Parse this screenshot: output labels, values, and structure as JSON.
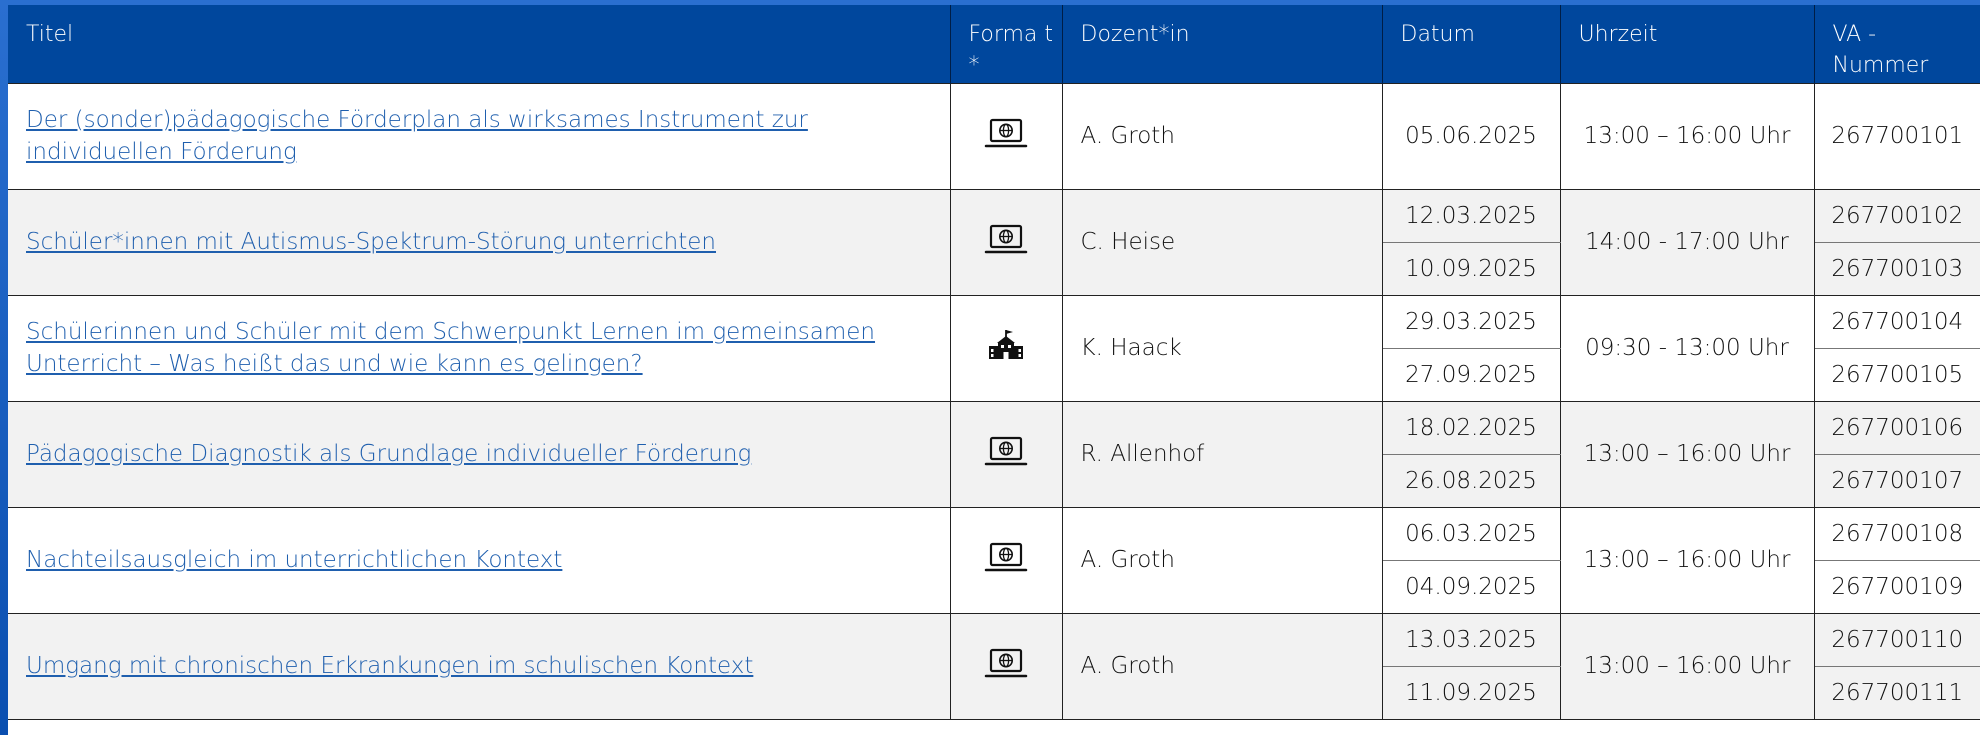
{
  "headers": {
    "titel": "Titel",
    "format": "Forma t *",
    "dozent": "Dozent*in",
    "datum": "Datum",
    "uhrzeit": "Uhrzeit",
    "va": "VA - Nummer"
  },
  "rows": [
    {
      "title": "Der (sonder)pädagogische Förderplan als wirksames Instrument zur individuellen Förderung",
      "format_icon": "laptop-globe-icon",
      "lecturer": "A. Groth",
      "dates": [
        "05.06.2025"
      ],
      "time": "13:00 – 16:00 Uhr",
      "va": [
        "267700101"
      ]
    },
    {
      "title": "Schüler*innen mit Autismus-Spektrum-Störung unterrichten",
      "format_icon": "laptop-globe-icon",
      "lecturer": "C. Heise",
      "dates": [
        "12.03.2025",
        "10.09.2025"
      ],
      "time": "14:00 - 17:00 Uhr",
      "va": [
        "267700102",
        "267700103"
      ]
    },
    {
      "title": "Schülerinnen und Schüler mit dem Schwerpunkt Lernen im gemeinsamen Unterricht – Was heißt das und wie kann es gelingen?",
      "format_icon": "school-building-icon",
      "lecturer": "K. Haack",
      "dates": [
        "29.03.2025",
        "27.09.2025"
      ],
      "time": "09:30 - 13:00 Uhr",
      "va": [
        "267700104",
        "267700105"
      ]
    },
    {
      "title": "Pädagogische Diagnostik als Grundlage individueller Förderung",
      "format_icon": "laptop-globe-icon",
      "lecturer": "R. Allenhof",
      "dates": [
        "18.02.2025",
        "26.08.2025"
      ],
      "time": "13:00 – 16:00 Uhr",
      "va": [
        "267700106",
        "267700107"
      ]
    },
    {
      "title": "Nachteilsausgleich im unterrichtlichen Kontext",
      "format_icon": "laptop-globe-icon",
      "lecturer": "A. Groth",
      "dates": [
        "06.03.2025",
        "04.09.2025"
      ],
      "time": "13:00 – 16:00 Uhr",
      "va": [
        "267700108",
        "267700109"
      ]
    },
    {
      "title": "Umgang mit chronischen Erkrankungen im schulischen Kontext",
      "format_icon": "laptop-globe-icon",
      "lecturer": "A. Groth",
      "dates": [
        "13.03.2025",
        "11.09.2025"
      ],
      "time": "13:00 – 16:00 Uhr",
      "va": [
        "267700110",
        "267700111"
      ]
    }
  ],
  "colors": {
    "header_bg": "#00479d",
    "link": "#1f5fae",
    "alt_row": "#f2f2f2"
  }
}
